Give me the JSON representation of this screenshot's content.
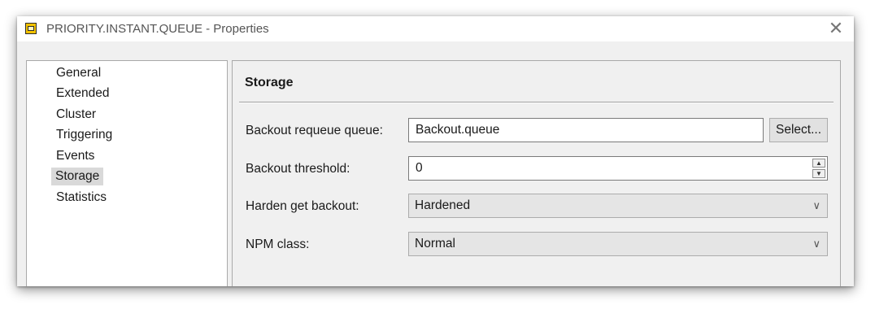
{
  "window": {
    "title": "PRIORITY.INSTANT.QUEUE - Properties",
    "icon": "queue-properties-icon",
    "close_glyph": "✕"
  },
  "nav": {
    "items": [
      {
        "label": "General"
      },
      {
        "label": "Extended"
      },
      {
        "label": "Cluster"
      },
      {
        "label": "Triggering"
      },
      {
        "label": "Events"
      },
      {
        "label": "Storage",
        "selected": true
      },
      {
        "label": "Statistics"
      }
    ]
  },
  "panel": {
    "section_title": "Storage",
    "fields": {
      "backout_requeue_queue": {
        "label": "Backout requeue queue:",
        "value": "Backout.queue",
        "button_label": "Select..."
      },
      "backout_threshold": {
        "label": "Backout threshold:",
        "value": "0"
      },
      "harden_get_backout": {
        "label": "Harden get backout:",
        "value": "Hardened"
      },
      "npm_class": {
        "label": "NPM class:",
        "value": "Normal"
      }
    }
  },
  "colors": {
    "dialog_background": "#f0f0f0",
    "selected_item": "#d9d9d9",
    "icon_yellow": "#f2c200"
  }
}
